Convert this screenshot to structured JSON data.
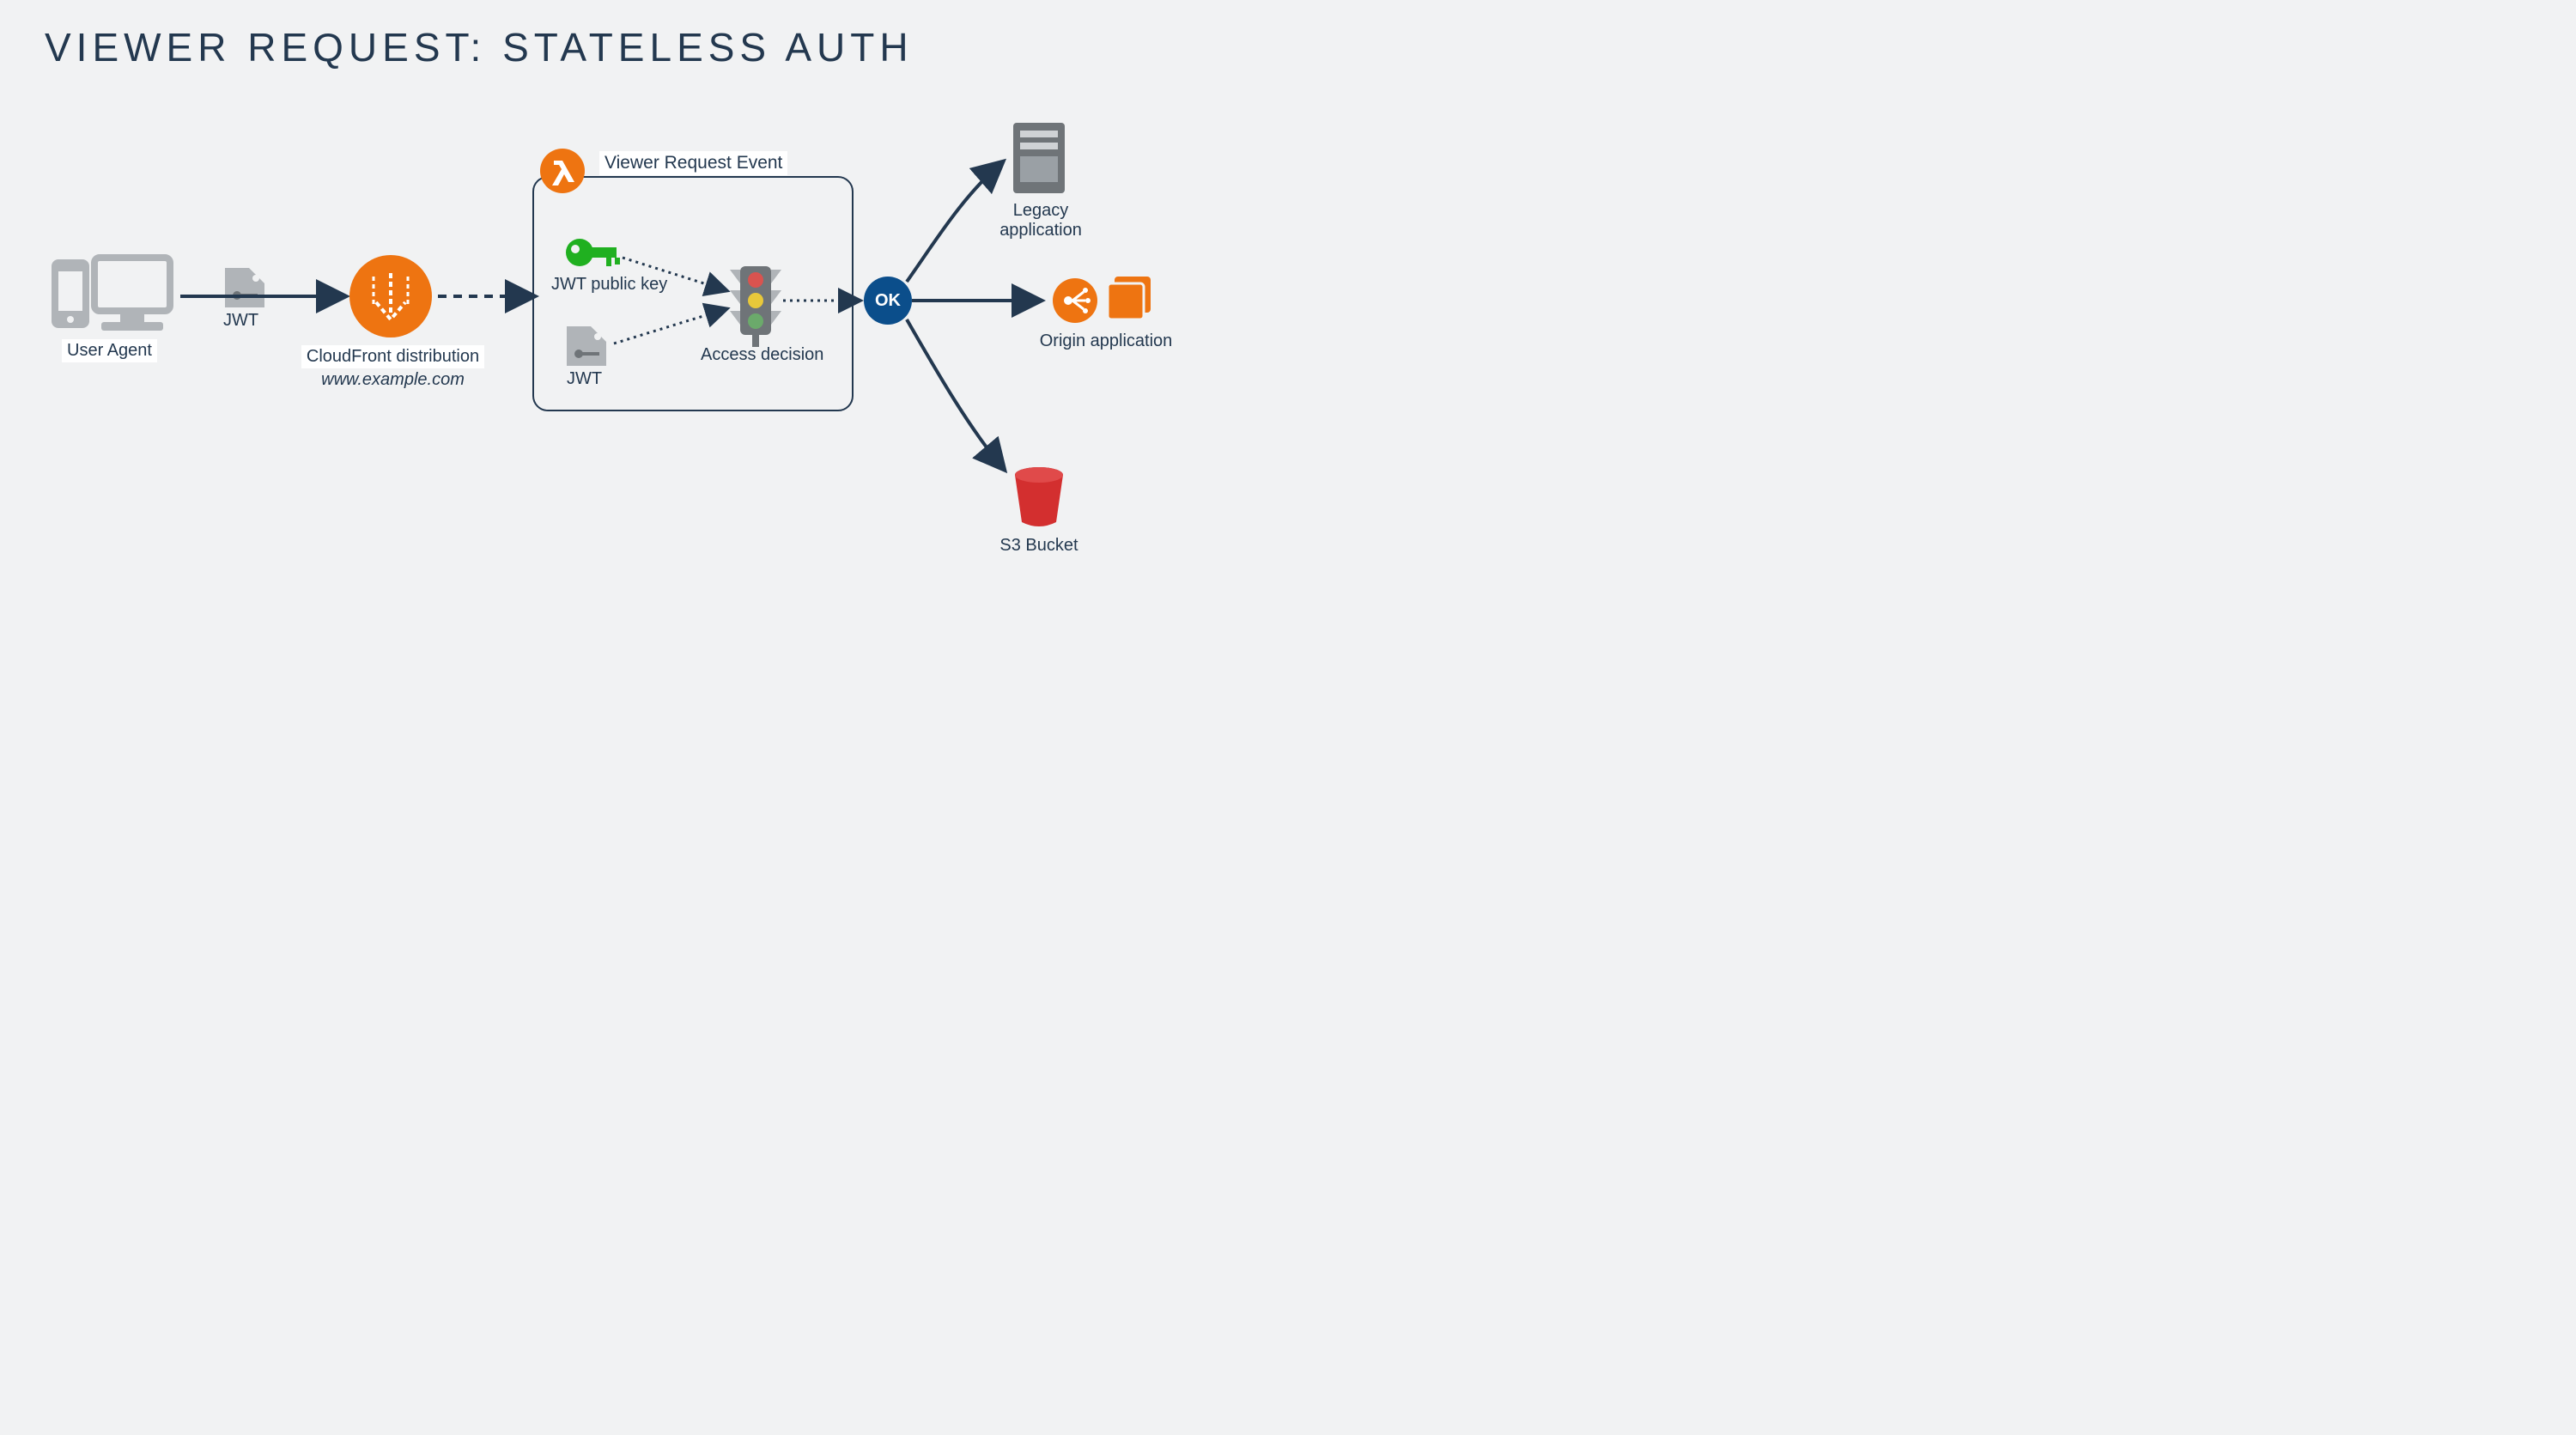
{
  "title": "VIEWER REQUEST: STATELESS AUTH",
  "nodes": {
    "user_agent": {
      "label": "User Agent"
    },
    "jwt_tag_1": {
      "label": "JWT"
    },
    "cloudfront": {
      "label": "CloudFront distribution",
      "sublabel": "www.example.com"
    },
    "lambda": {
      "icon": "lambda"
    },
    "viewer_event": {
      "label": "Viewer Request Event"
    },
    "jwt_key": {
      "label": "JWT public key"
    },
    "jwt_tag_2": {
      "label": "JWT"
    },
    "access_decision": {
      "label": "Access decision"
    },
    "ok": {
      "label": "OK"
    },
    "legacy": {
      "label": "Legacy application"
    },
    "origin": {
      "label": "Origin application"
    },
    "s3": {
      "label": "S3 Bucket"
    }
  },
  "colors": {
    "orange": "#ee7411",
    "dark": "#23384f",
    "navy": "#0b4e8b",
    "green": "#20b020",
    "red": "#d32f2f",
    "yellow": "#e8c83a",
    "grey": "#b0b4b8",
    "grey_dark": "#6f7478"
  }
}
